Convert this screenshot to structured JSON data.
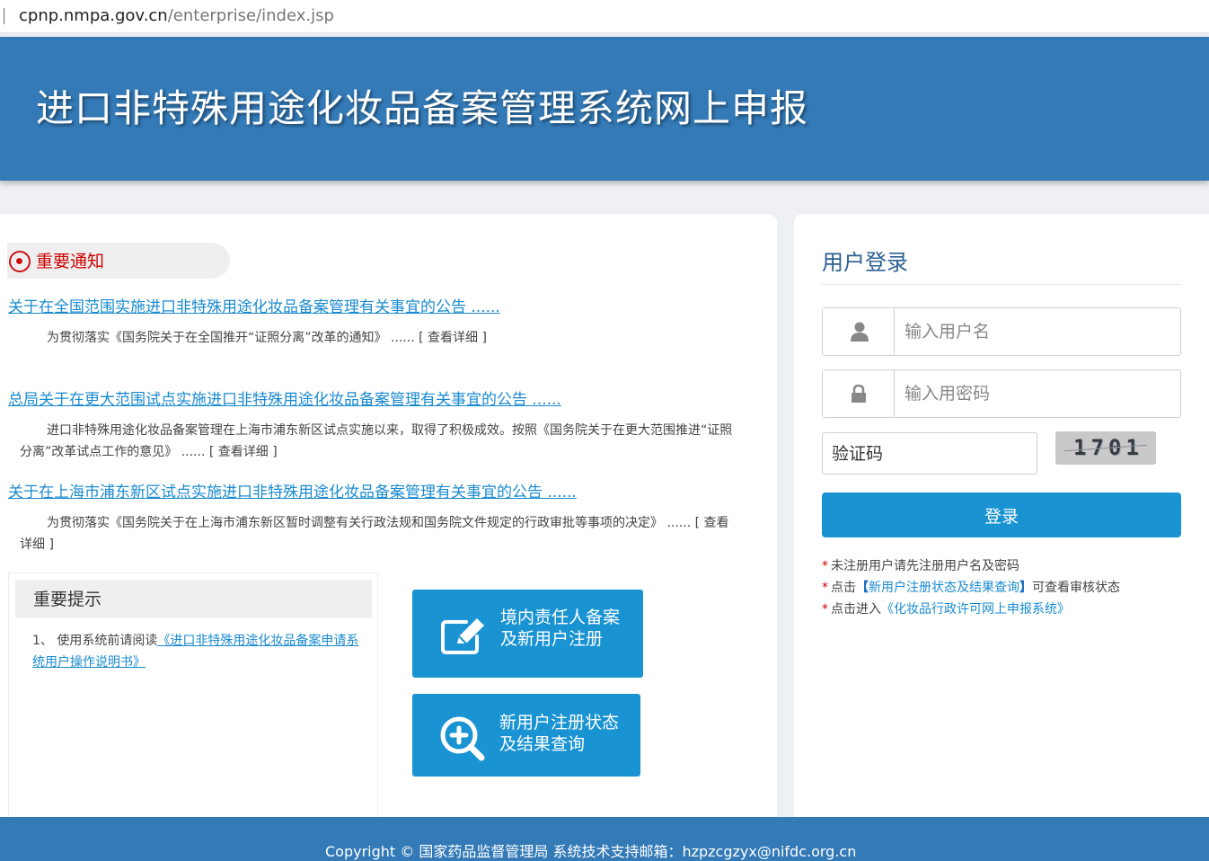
{
  "browser": {
    "url_host": "cpnp.nmpa.gov.cn",
    "url_path": "/enterprise/index.jsp"
  },
  "header": {
    "title": "进口非特殊用途化妆品备案管理系统网上申报"
  },
  "notices": {
    "section_title": "重要通知",
    "items": [
      {
        "title": "关于在全国范围实施进口非特殊用途化妆品备案管理有关事宜的公告 ......",
        "summary": "为贯彻落实《国务院关于在全国推开“证照分离”改革的通知》 ......",
        "more": "[ 查看详细 ]"
      },
      {
        "title": "总局关于在更大范围试点实施进口非特殊用途化妆品备案管理有关事宜的公告 ......",
        "summary": "进口非特殊用途化妆品备案管理在上海市浦东新区试点实施以来，取得了积极成效。按照《国务院关于在更大范围推进“证照分离”改革试点工作的意见》 ......",
        "more": "[ 查看详细 ]"
      },
      {
        "title": "关于在上海市浦东新区试点实施进口非特殊用途化妆品备案管理有关事宜的公告 ......",
        "summary": "为贯彻落实《国务院关于在上海市浦东新区暂时调整有关行政法规和国务院文件规定的行政审批等事项的决定》 ......",
        "more": "[ 查看详细 ]"
      }
    ]
  },
  "tips": {
    "title": "重要提示",
    "item_prefix": "1、 使用系统前请阅读",
    "item_link": "《进口非特殊用途化妆品备案申请系统用户操作说明书》"
  },
  "actions": {
    "register": {
      "line1": "境内责任人备案",
      "line2": "及新用户注册",
      "icon": "edit-icon"
    },
    "status": {
      "line1": "新用户注册状态",
      "line2": "及结果查询",
      "icon": "zoom-in-icon"
    }
  },
  "login": {
    "title": "用户登录",
    "username_placeholder": "输入用户名",
    "password_placeholder": "输入用密码",
    "captcha_placeholder": "验证码",
    "captcha_code": "1701",
    "submit_label": "登录",
    "note1": "未注册用户请先注册用户名及密码",
    "note2_prefix": "点击",
    "note2_link": "新用户注册状态及结果查询",
    "note2_suffix": "可查看审核状态",
    "note3_prefix": "点击进入",
    "note3_link": "《化妆品行政许可网上申报系统》",
    "star": "*",
    "bracket_open": "【",
    "bracket_close": "】"
  },
  "footer": {
    "text": "Copyright © 国家药品监督管理局    系统技术支持邮箱：hzpzcgzyx@nifdc.org.cn"
  },
  "colors": {
    "header_blue": "#337ab7",
    "button_blue": "#1a93d3",
    "link_blue": "#1a8bd0",
    "notice_red": "#cc0000"
  }
}
